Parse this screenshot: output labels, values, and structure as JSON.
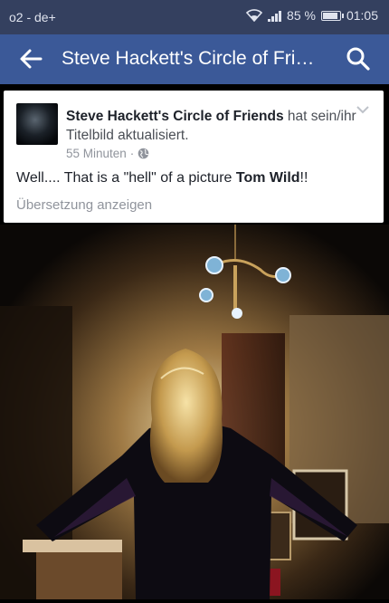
{
  "status_bar": {
    "carrier": "o2 - de+",
    "battery": "85 %",
    "battery_level": 0.85,
    "time": "01:05",
    "icons": [
      "wifi-icon",
      "signal-icon",
      "battery-icon"
    ]
  },
  "app_bar": {
    "title": "Steve Hackett's Circle of Friends",
    "back_icon": "arrow-left-icon",
    "search_icon": "search-icon",
    "color": "#3b5998"
  },
  "post": {
    "page_name": "Steve Hackett's Circle of Friends",
    "action_text": " hat sein/ihr Titelbild aktualisiert.",
    "time": "55 Minuten",
    "separator": "·",
    "privacy_icon": "globe-icon",
    "text_before": "Well.... That is a \"hell\" of a picture ",
    "mention": "Tom Wild",
    "text_after": "!!",
    "translate_label": "Übersetzung anzeigen",
    "menu_icon": "chevron-down-icon"
  },
  "photo": {
    "subject": "cover-photo"
  }
}
